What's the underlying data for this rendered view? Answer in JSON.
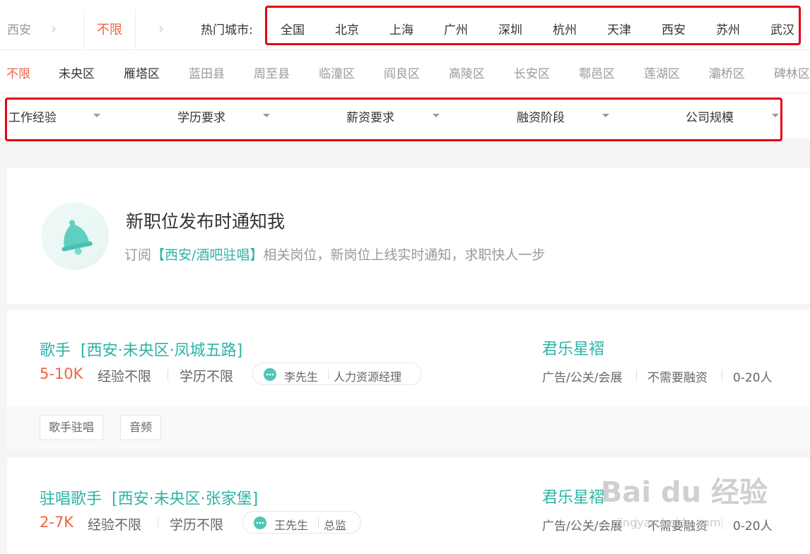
{
  "breadcrumb": {
    "city": "西安",
    "filter": "不限"
  },
  "hot_cities": {
    "label": "热门城市:",
    "items": [
      "全国",
      "北京",
      "上海",
      "广州",
      "深圳",
      "杭州",
      "天津",
      "西安",
      "苏州",
      "武汉"
    ]
  },
  "districts": [
    "不限",
    "未央区",
    "雁塔区",
    "蓝田县",
    "周至县",
    "临潼区",
    "阎良区",
    "高陵区",
    "长安区",
    "鄠邑区",
    "莲湖区",
    "灞桥区",
    "碑林区"
  ],
  "filters": [
    "工作经验",
    "学历要求",
    "薪资要求",
    "融资阶段",
    "公司规模"
  ],
  "notify": {
    "title": "新职位发布时通知我",
    "sub_prefix": "订阅",
    "keyword": "【西安/酒吧驻唱】",
    "sub_suffix": "相关岗位，新岗位上线实时通知，求职快人一步"
  },
  "jobs": [
    {
      "title": "歌手",
      "location": "[西安·未央区·凤城五路]",
      "salary": "5-10K",
      "experience": "经验不限",
      "education": "学历不限",
      "hr_name": "李先生",
      "hr_title": "人力资源经理",
      "company": "君乐星褶",
      "industry": "广告/公关/会展",
      "funding": "不需要融资",
      "size": "0-20人",
      "tags": [
        "歌手驻唱",
        "音频"
      ]
    },
    {
      "title": "驻唱歌手",
      "location": "[西安·未央区·张家堡]",
      "salary": "2-7K",
      "experience": "经验不限",
      "education": "学历不限",
      "hr_name": "王先生",
      "hr_title": "总监",
      "company": "君乐星褶",
      "industry": "广告/公关/会展",
      "funding": "不需要融资",
      "size": "0-20人"
    }
  ],
  "watermark": {
    "brand": "Bai du 经验",
    "url": "jingyan.baidu.com"
  },
  "colors": {
    "accent": "#2cb3a6",
    "salary": "#ee6440",
    "highlight_box": "#e60012"
  }
}
